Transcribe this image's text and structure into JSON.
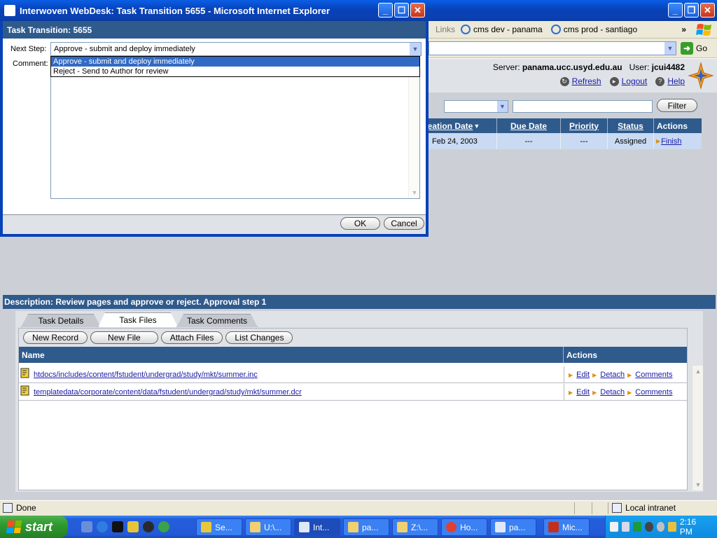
{
  "dialog": {
    "window_title": "Interwoven WebDesk: Task Transition 5655 - Microsoft Internet Explorer",
    "header": "Task Transition: 5655",
    "next_step_label": "Next Step:",
    "next_step_value": "Approve - submit and deploy immediately",
    "comment_label": "Comment:",
    "options": [
      "Approve - submit and deploy immediately",
      "Reject - Send to Author for review"
    ],
    "ok_label": "OK",
    "cancel_label": "Cancel"
  },
  "browser": {
    "links_label": "Links",
    "links": [
      "cms dev - panama",
      "cms prod - santiago"
    ],
    "go_label": "Go"
  },
  "header": {
    "server_label": "Server:",
    "server": "panama.ucc.usyd.edu.au",
    "user_label": "User:",
    "user": "jcui4482",
    "refresh": "Refresh",
    "logout": "Logout",
    "help": "Help"
  },
  "filter": {
    "button": "Filter"
  },
  "task_table": {
    "columns": [
      "reation Date",
      "Due Date",
      "Priority",
      "Status",
      "Actions"
    ],
    "row": {
      "creation_date": "Feb 24, 2003",
      "due_date": "---",
      "priority": "---",
      "status": "Assigned",
      "action": "Finish"
    }
  },
  "description": "Description: Review pages and approve or reject. Approval step 1",
  "tabs": [
    "Task Details",
    "Task Files",
    "Task Comments"
  ],
  "active_tab": "Task Files",
  "file_buttons": [
    "New Record",
    "New File",
    "Attach Files",
    "List Changes"
  ],
  "files": {
    "columns": [
      "Name",
      "Actions"
    ],
    "rows": [
      {
        "name": "htdocs/includes/content/fstudent/undergrad/study/mkt/summer.inc",
        "actions": [
          "Edit",
          "Detach",
          "Comments"
        ]
      },
      {
        "name": "templatedata/corporate/content/data/fstudent/undergrad/study/mkt/summer.dcr",
        "actions": [
          "Edit",
          "Detach",
          "Comments"
        ]
      }
    ]
  },
  "statusbar": {
    "status": "Done",
    "zone": "Local intranet"
  },
  "taskbar": {
    "start_label": "start",
    "buttons": [
      "Se...",
      "U:\\...",
      "Int...",
      "pa...",
      "Z:\\...",
      "Ho...",
      "pa...",
      "Mic..."
    ],
    "clock": "2:16 PM"
  },
  "colors": {
    "header_blue": "#2f5a8c",
    "selection_blue": "#316ac5",
    "xp_title_blue": "#0842b8",
    "row_highlight": "#c9daf2"
  }
}
